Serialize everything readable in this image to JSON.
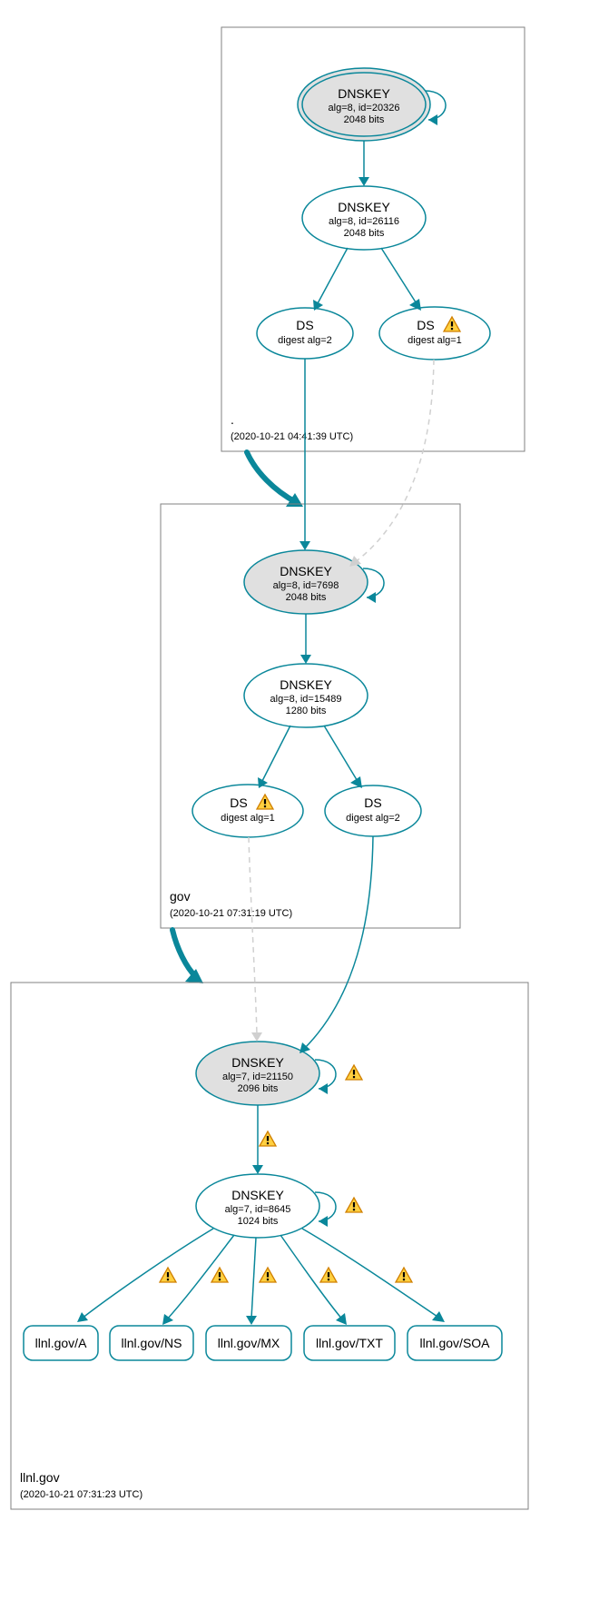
{
  "zones": {
    "root": {
      "label": ".",
      "timestamp": "(2020-10-21 04:41:39 UTC)"
    },
    "gov": {
      "label": "gov",
      "timestamp": "(2020-10-21 07:31:19 UTC)"
    },
    "llnl": {
      "label": "llnl.gov",
      "timestamp": "(2020-10-21 07:31:23 UTC)"
    }
  },
  "nodes": {
    "root_ksk": {
      "title": "DNSKEY",
      "l2": "alg=8, id=20326",
      "l3": "2048 bits"
    },
    "root_zsk": {
      "title": "DNSKEY",
      "l2": "alg=8, id=26116",
      "l3": "2048 bits"
    },
    "root_ds2": {
      "title": "DS",
      "l2": "digest alg=2"
    },
    "root_ds1": {
      "title": "DS",
      "l2": "digest alg=1"
    },
    "gov_ksk": {
      "title": "DNSKEY",
      "l2": "alg=8, id=7698",
      "l3": "2048 bits"
    },
    "gov_zsk": {
      "title": "DNSKEY",
      "l2": "alg=8, id=15489",
      "l3": "1280 bits"
    },
    "gov_ds1": {
      "title": "DS",
      "l2": "digest alg=1"
    },
    "gov_ds2": {
      "title": "DS",
      "l2": "digest alg=2"
    },
    "llnl_ksk": {
      "title": "DNSKEY",
      "l2": "alg=7, id=21150",
      "l3": "2096 bits"
    },
    "llnl_zsk": {
      "title": "DNSKEY",
      "l2": "alg=7, id=8645",
      "l3": "1024 bits"
    },
    "rr_a": "llnl.gov/A",
    "rr_ns": "llnl.gov/NS",
    "rr_mx": "llnl.gov/MX",
    "rr_txt": "llnl.gov/TXT",
    "rr_soa": "llnl.gov/SOA"
  },
  "chart_data": {
    "type": "graph",
    "description": "DNSSEC authentication chain from root zone through gov to llnl.gov",
    "zones": [
      {
        "name": ".",
        "timestamp": "2020-10-21 04:41:39 UTC"
      },
      {
        "name": "gov",
        "timestamp": "2020-10-21 07:31:19 UTC"
      },
      {
        "name": "llnl.gov",
        "timestamp": "2020-10-21 07:31:23 UTC"
      }
    ],
    "nodes": [
      {
        "id": "root_ksk",
        "zone": ".",
        "type": "DNSKEY",
        "alg": 8,
        "keyid": 20326,
        "bits": 2048,
        "role": "trust-anchor"
      },
      {
        "id": "root_zsk",
        "zone": ".",
        "type": "DNSKEY",
        "alg": 8,
        "keyid": 26116,
        "bits": 2048
      },
      {
        "id": "root_ds2",
        "zone": ".",
        "type": "DS",
        "digest_alg": 2
      },
      {
        "id": "root_ds1",
        "zone": ".",
        "type": "DS",
        "digest_alg": 1,
        "warning": true
      },
      {
        "id": "gov_ksk",
        "zone": "gov",
        "type": "DNSKEY",
        "alg": 8,
        "keyid": 7698,
        "bits": 2048
      },
      {
        "id": "gov_zsk",
        "zone": "gov",
        "type": "DNSKEY",
        "alg": 8,
        "keyid": 15489,
        "bits": 1280
      },
      {
        "id": "gov_ds1",
        "zone": "gov",
        "type": "DS",
        "digest_alg": 1,
        "warning": true
      },
      {
        "id": "gov_ds2",
        "zone": "gov",
        "type": "DS",
        "digest_alg": 2
      },
      {
        "id": "llnl_ksk",
        "zone": "llnl.gov",
        "type": "DNSKEY",
        "alg": 7,
        "keyid": 21150,
        "bits": 2096,
        "warning": true
      },
      {
        "id": "llnl_zsk",
        "zone": "llnl.gov",
        "type": "DNSKEY",
        "alg": 7,
        "keyid": 8645,
        "bits": 1024,
        "warning": true
      },
      {
        "id": "rr_a",
        "zone": "llnl.gov",
        "type": "RRset",
        "name": "llnl.gov/A",
        "warning": true
      },
      {
        "id": "rr_ns",
        "zone": "llnl.gov",
        "type": "RRset",
        "name": "llnl.gov/NS",
        "warning": true
      },
      {
        "id": "rr_mx",
        "zone": "llnl.gov",
        "type": "RRset",
        "name": "llnl.gov/MX",
        "warning": true
      },
      {
        "id": "rr_txt",
        "zone": "llnl.gov",
        "type": "RRset",
        "name": "llnl.gov/TXT",
        "warning": true
      },
      {
        "id": "rr_soa",
        "zone": "llnl.gov",
        "type": "RRset",
        "name": "llnl.gov/SOA",
        "warning": true
      }
    ],
    "edges": [
      {
        "from": "root_ksk",
        "to": "root_ksk",
        "style": "solid"
      },
      {
        "from": "root_ksk",
        "to": "root_zsk",
        "style": "solid"
      },
      {
        "from": "root_zsk",
        "to": "root_ds2",
        "style": "solid"
      },
      {
        "from": "root_zsk",
        "to": "root_ds1",
        "style": "solid"
      },
      {
        "from": "root_ds2",
        "to": "gov_ksk",
        "style": "solid"
      },
      {
        "from": "root_ds1",
        "to": "gov_ksk",
        "style": "dashed"
      },
      {
        "from": "gov_ksk",
        "to": "gov_ksk",
        "style": "solid"
      },
      {
        "from": "gov_ksk",
        "to": "gov_zsk",
        "style": "solid"
      },
      {
        "from": "gov_zsk",
        "to": "gov_ds1",
        "style": "solid"
      },
      {
        "from": "gov_zsk",
        "to": "gov_ds2",
        "style": "solid"
      },
      {
        "from": "gov_ds1",
        "to": "llnl_ksk",
        "style": "dashed"
      },
      {
        "from": "gov_ds2",
        "to": "llnl_ksk",
        "style": "solid"
      },
      {
        "from": "llnl_ksk",
        "to": "llnl_ksk",
        "style": "solid",
        "warning": true
      },
      {
        "from": "llnl_ksk",
        "to": "llnl_zsk",
        "style": "solid",
        "warning": true
      },
      {
        "from": "llnl_zsk",
        "to": "llnl_zsk",
        "style": "solid",
        "warning": true
      },
      {
        "from": "llnl_zsk",
        "to": "rr_a",
        "style": "solid",
        "warning": true
      },
      {
        "from": "llnl_zsk",
        "to": "rr_ns",
        "style": "solid",
        "warning": true
      },
      {
        "from": "llnl_zsk",
        "to": "rr_mx",
        "style": "solid",
        "warning": true
      },
      {
        "from": "llnl_zsk",
        "to": "rr_txt",
        "style": "solid",
        "warning": true
      },
      {
        "from": "llnl_zsk",
        "to": "rr_soa",
        "style": "solid",
        "warning": true
      }
    ]
  }
}
